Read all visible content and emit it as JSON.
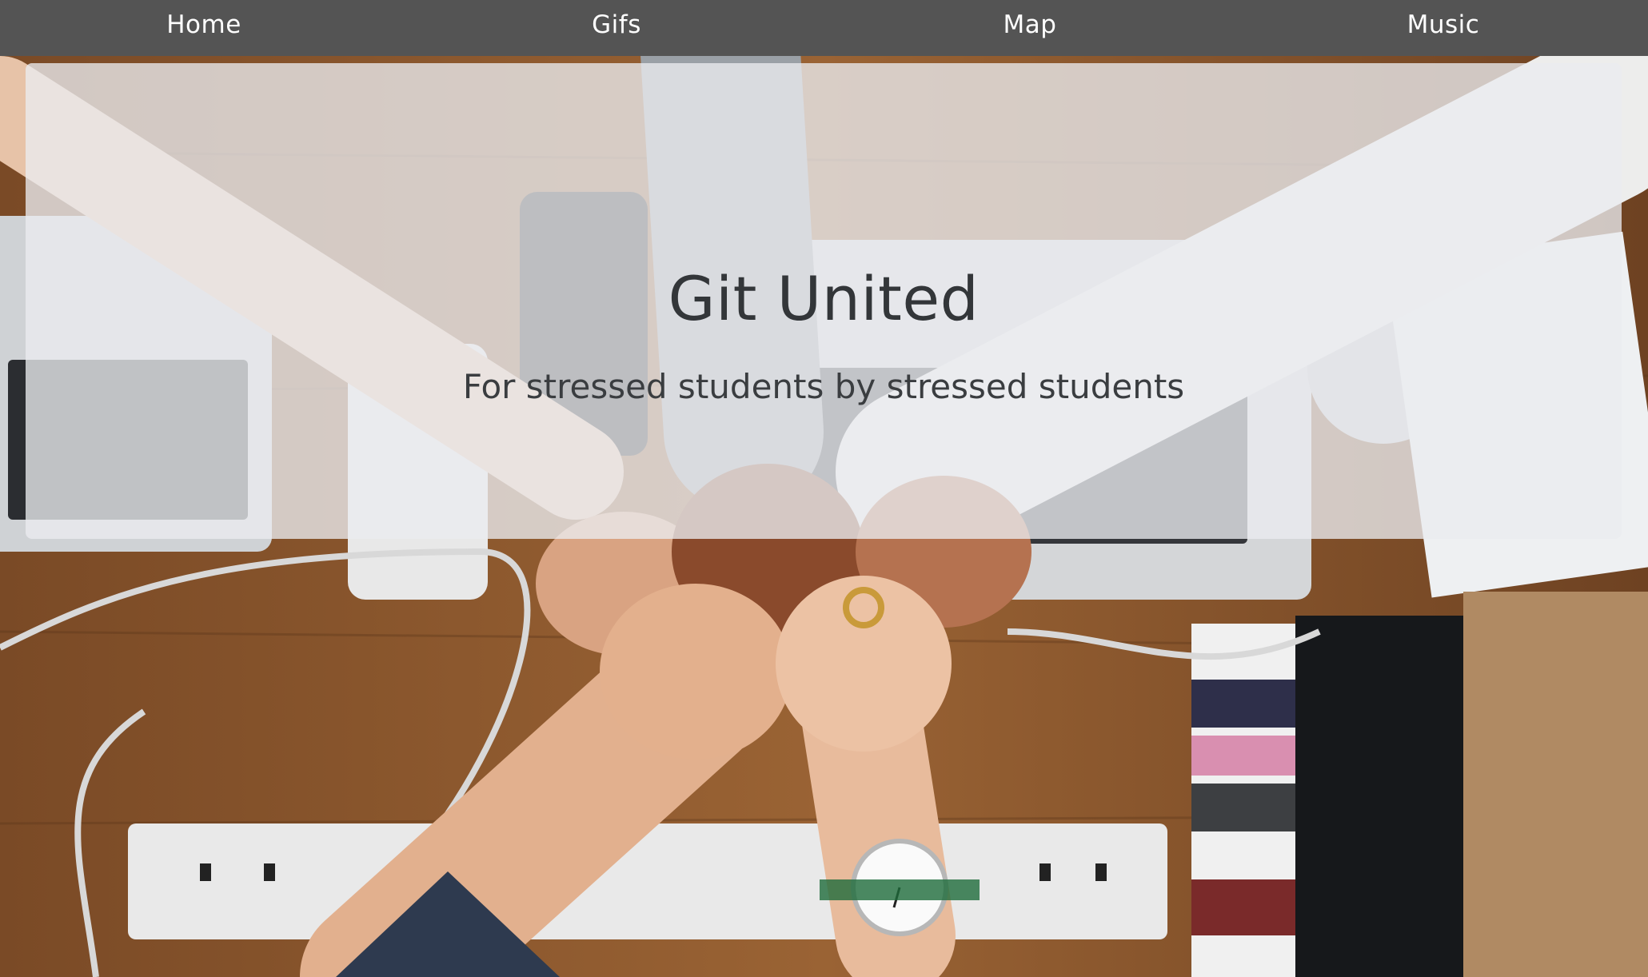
{
  "nav": {
    "items": [
      {
        "label": "Home"
      },
      {
        "label": "Gifs"
      },
      {
        "label": "Map"
      },
      {
        "label": "Music"
      }
    ]
  },
  "jumbotron": {
    "title": "Git United",
    "subtitle": "For stressed students by stressed students"
  },
  "colors": {
    "nav_background": "#545454",
    "nav_text": "#ffffff",
    "jumbotron_background": "#eaecef",
    "heading_text": "#333639"
  },
  "hero_image": {
    "icon": "team-fist-bump-photo"
  }
}
